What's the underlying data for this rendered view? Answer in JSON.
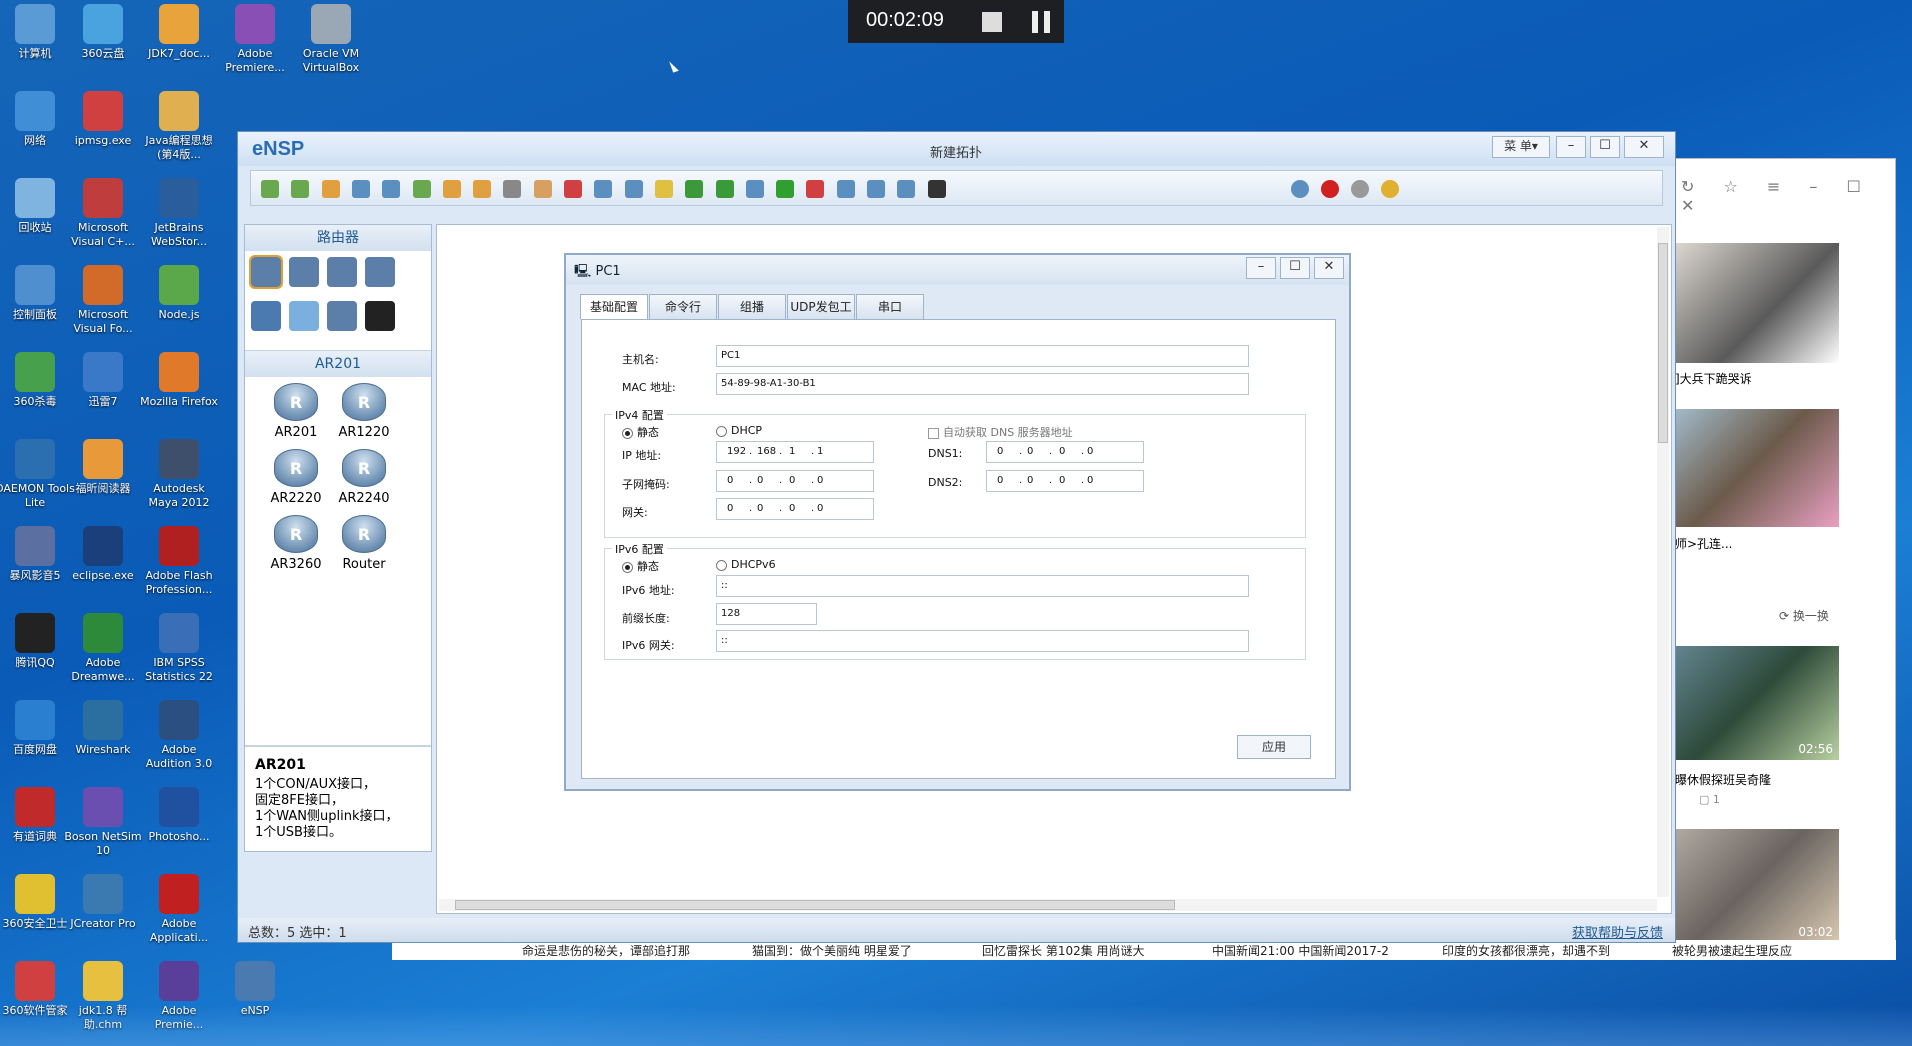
{
  "recorder": {
    "time": "00:02:09"
  },
  "desktop": {
    "icons": [
      "计算机",
      "360云盘",
      "JDK7_doc...",
      "Adobe Premiere...",
      "Oracle VM VirtualBox",
      "网络",
      "ipmsg.exe",
      "Java编程思想(第4版...",
      "回收站",
      "Microsoft Visual C+...",
      "JetBrains WebStor...",
      "控制面板",
      "Microsoft Visual Fo...",
      "Node.js",
      "360杀毒",
      "迅雷7",
      "Mozilla Firefox",
      "DAEMON Tools Lite",
      "福昕阅读器",
      "Autodesk Maya 2012",
      "暴风影音5",
      "eclipse.exe",
      "Adobe Flash Profession...",
      "腾讯QQ",
      "Adobe Dreamwe...",
      "IBM SPSS Statistics 22",
      "百度网盘",
      "Wireshark",
      "Adobe Audition 3.0",
      "有道词典",
      "Boson NetSim 10",
      "Photosho...",
      "360安全卫士",
      "JCreator Pro",
      "Adobe Applicati...",
      "360软件管家",
      "jdk1.8 帮助.chm",
      "Adobe Premie...",
      "eNSP"
    ]
  },
  "ensp": {
    "logo": "eNSP",
    "title": "新建拓扑",
    "menu": "菜 单▾",
    "section_router": "路由器",
    "section_ar": "AR201",
    "devices": [
      "AR201",
      "AR1220",
      "AR2220",
      "AR2240",
      "AR3260",
      "Router"
    ],
    "desc_title": "AR201",
    "desc_lines": [
      "1个CON/AUX接口，",
      "固定8FE接口，",
      "1个WAN侧uplink接口，",
      "1个USB接口。"
    ],
    "status_left": "总数：5  选中：1",
    "status_right": "获取帮助与反馈"
  },
  "dialog": {
    "title": "PC1",
    "tabs": [
      "基础配置",
      "命令行",
      "组播",
      "UDP发包工具",
      "串口"
    ],
    "hostname_label": "主机名:",
    "hostname": "PC1",
    "mac_label": "MAC 地址:",
    "mac": "54-89-98-A1-30-B1",
    "ipv4_group": "IPv4 配置",
    "static": "静态",
    "dhcp": "DHCP",
    "auto_dns": "自动获取 DNS 服务器地址",
    "ip_label": "IP 地址:",
    "ip": [
      "192",
      "168",
      "1",
      "1"
    ],
    "mask_label": "子网掩码:",
    "mask": [
      "0",
      "0",
      "0",
      "0"
    ],
    "gw_label": "网关:",
    "gw": [
      "0",
      "0",
      "0",
      "0"
    ],
    "dns1_label": "DNS1:",
    "dns1": [
      "0",
      "0",
      "0",
      "0"
    ],
    "dns2_label": "DNS2:",
    "dns2": [
      "0",
      "0",
      "0",
      "0"
    ],
    "ipv6_group": "IPv6 配置",
    "static6": "静态",
    "dhcpv6": "DHCPv6",
    "ipv6_label": "IPv6 地址:",
    "ipv6": "::",
    "prefix_label": "前缀长度:",
    "prefix": "128",
    "gw6_label": "IPv6 网关:",
    "gw6": "::",
    "apply": "应用"
  },
  "browser": {
    "captions": [
      "奇]大兵下跪哭诉",
      "老师>孔连...",
      "自曝休假探班吴奇隆"
    ],
    "refresh": "换一换",
    "durations": [
      "02:56",
      "03:02"
    ],
    "comments": "1",
    "news": [
      "命运是悲伤的秘关，谭部追打那",
      "猫国到：做个美丽纯 明星爱了",
      "回忆雷探长 第102集 用尚谜大",
      "中国新闻21:00 中国新闻2017-2",
      "印度的女孩都很漂亮，却遇不到",
      "被轮男被逮起生理反应"
    ]
  }
}
